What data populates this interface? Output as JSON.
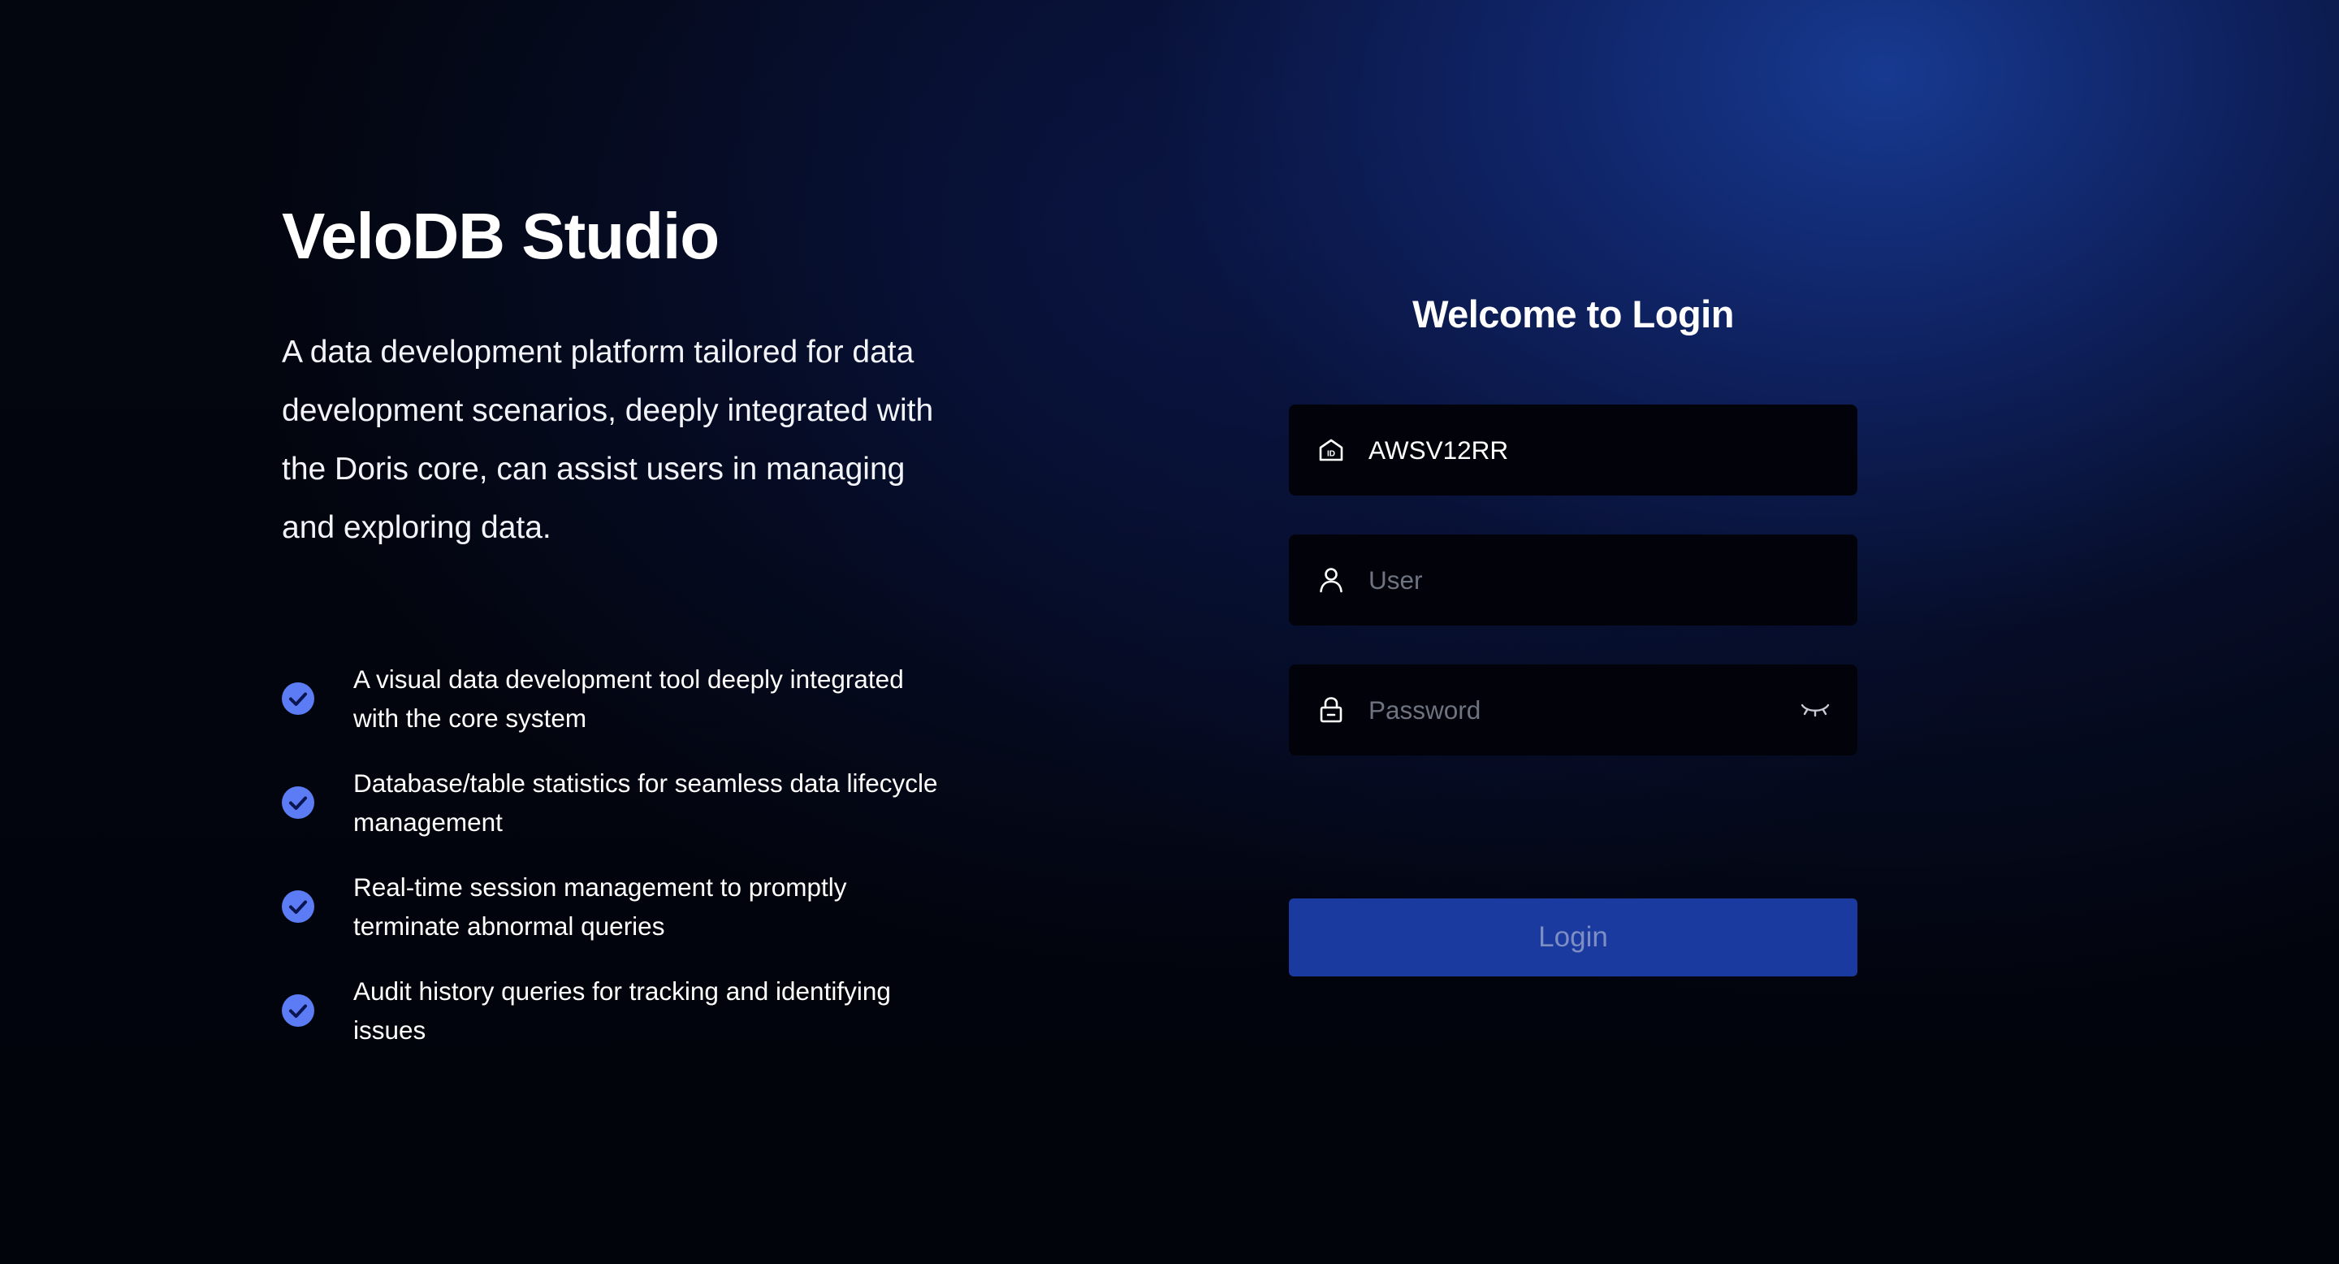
{
  "brand": {
    "title": "VeloDB Studio",
    "description": "A data development platform tailored for data development scenarios, deeply integrated with the Doris core, can assist users in managing and exploring data."
  },
  "features": [
    {
      "text": "A visual data development tool deeply integrated with the core system",
      "icon": "check-circle-icon"
    },
    {
      "text": "Database/table statistics for seamless data lifecycle management",
      "icon": "check-circle-icon"
    },
    {
      "text": "Real-time session management to promptly terminate abnormal queries",
      "icon": "check-circle-icon"
    },
    {
      "text": "Audit history queries for tracking and identifying issues",
      "icon": "check-circle-icon"
    }
  ],
  "login": {
    "title": "Welcome to Login",
    "id_field": {
      "value": "AWSV12RR",
      "placeholder": "",
      "icon": "id-card-icon"
    },
    "user_field": {
      "value": "",
      "placeholder": "User",
      "icon": "user-icon"
    },
    "password_field": {
      "value": "",
      "placeholder": "Password",
      "icon": "lock-icon",
      "toggle_icon": "eye-closed-icon"
    },
    "button_label": "Login"
  },
  "colors": {
    "accent": "#5b7cf5",
    "button_bg": "#1a3aa0",
    "button_text": "#7d8ec2",
    "field_bg": "#02030a",
    "placeholder": "#6e7380"
  }
}
